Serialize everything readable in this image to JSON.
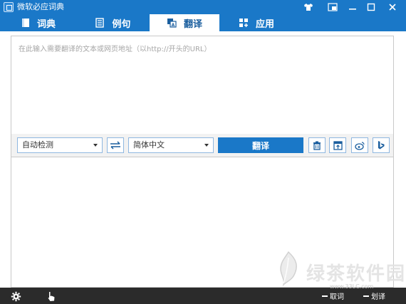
{
  "window": {
    "title": "微软必应词典"
  },
  "tabs": [
    {
      "label": "词典",
      "icon": "book-icon",
      "active": false
    },
    {
      "label": "例句",
      "icon": "document-icon",
      "active": false
    },
    {
      "label": "翻译",
      "icon": "translate-icon",
      "active": true
    },
    {
      "label": "应用",
      "icon": "apps-icon",
      "active": false
    }
  ],
  "translate": {
    "input_placeholder": "在此输入需要翻译的文本或网页地址（以http://开头的URL）",
    "source_language": "自动检测",
    "target_language": "简体中文",
    "translate_button": "翻译",
    "output_text": ""
  },
  "status_bar": {
    "item1": "取词",
    "item2": "划译"
  },
  "watermark": {
    "text": "绿茶软件园",
    "url": "www.33LC.com"
  },
  "colors": {
    "accent": "#1a78c8",
    "status_bar": "#2b2b2b",
    "panel_bg": "#f2f2f2"
  }
}
